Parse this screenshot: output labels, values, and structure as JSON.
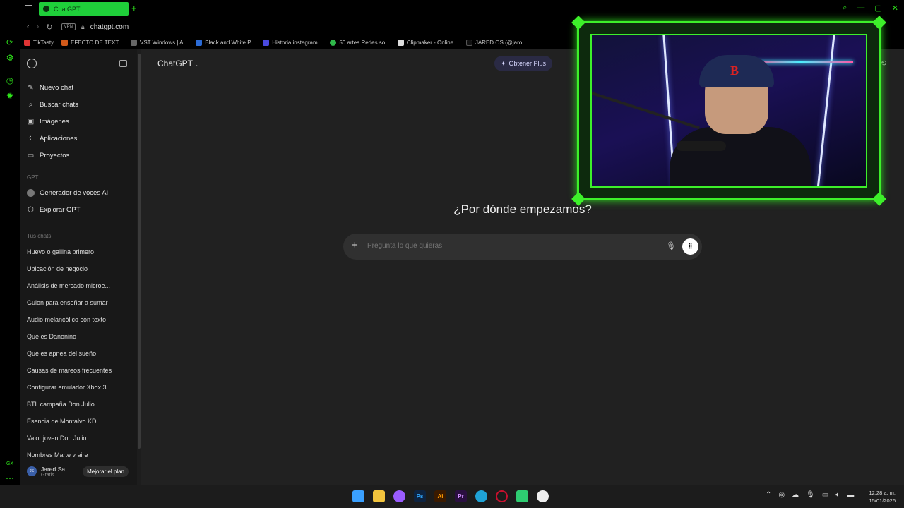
{
  "browser": {
    "tab_title": "ChatGPT",
    "url": "chatgpt.com",
    "vpn_label": "VPN",
    "bookmarks": [
      {
        "label": "TikTasty",
        "color": "#e03434"
      },
      {
        "label": "EFECTO DE TEXT...",
        "color": "#d25a1a"
      },
      {
        "label": "VST Windows | A...",
        "color": "#666666"
      },
      {
        "label": "Black and White P...",
        "color": "#2b6bd6"
      },
      {
        "label": "Historia instagram...",
        "color": "#4a4ae0"
      },
      {
        "label": "50 artes Redes so...",
        "color": "#2fb84a"
      },
      {
        "label": "Clipmaker - Online...",
        "color": "#dddddd"
      },
      {
        "label": "JARED OS (@jaro...",
        "color": "#111111"
      }
    ]
  },
  "sidebar": {
    "nav": [
      {
        "label": "Nuevo chat",
        "icon": "edit-icon"
      },
      {
        "label": "Buscar chats",
        "icon": "search-icon"
      },
      {
        "label": "Imágenes",
        "icon": "images-icon"
      },
      {
        "label": "Aplicaciones",
        "icon": "apps-icon"
      },
      {
        "label": "Proyectos",
        "icon": "folder-icon"
      }
    ],
    "gpt_section_label": "GPT",
    "gpts": [
      {
        "label": "Generador de voces AI",
        "icon": "gpt-avatar-icon"
      },
      {
        "label": "Explorar GPT",
        "icon": "cube-icon"
      }
    ],
    "chats_section_label": "Tus chats",
    "chats": [
      "Huevo o gallina primero",
      "Ubicación de negocio",
      "Análisis de mercado microe...",
      "Guion para enseñar a sumar",
      "Audio melancólico con texto",
      "Qué es Danonino",
      "Qué es apnea del sueño",
      "Causas de mareos frecuentes",
      "Configurar emulador Xbox 3...",
      "BTL campaña Don Julio",
      "Esencia de Montalvo KD",
      "Valor joven Don Julio",
      "Nombres Marte y aire"
    ],
    "user": {
      "initials": "JS",
      "name": "Jared Sa...",
      "plan": "Gratis",
      "upgrade_label": "Mejorar el plan"
    }
  },
  "main": {
    "model_label": "ChatGPT",
    "plus_button_label": "Obtener Plus",
    "headline": "¿Por dónde empezamos?",
    "composer_placeholder": "Pregunta lo que quieras"
  },
  "webcam": {
    "cap_logo": "B"
  },
  "taskbar": {
    "apps": [
      {
        "name": "windows-start",
        "label": "",
        "color": "#3aa0ff"
      },
      {
        "name": "file-explorer",
        "label": "",
        "color": "#f2c43d"
      },
      {
        "name": "copilot",
        "label": "",
        "color": "#9a5cff"
      },
      {
        "name": "photoshop",
        "label": "Ps",
        "color": "#0d2340"
      },
      {
        "name": "illustrator",
        "label": "Ai",
        "color": "#3a1a00"
      },
      {
        "name": "premiere",
        "label": "Pr",
        "color": "#2a0f40"
      },
      {
        "name": "edge",
        "label": "",
        "color": "#1fa3d6"
      },
      {
        "name": "opera",
        "label": "",
        "color": "#c8102e"
      },
      {
        "name": "gx-app",
        "label": "",
        "color": "#2ecc71"
      },
      {
        "name": "obs",
        "label": "",
        "color": "#eeeeee"
      }
    ],
    "time": "12:28 a. m.",
    "date": "15/01/2026"
  }
}
